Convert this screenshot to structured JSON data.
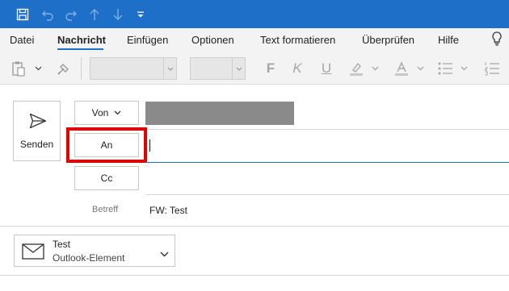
{
  "titlebar": {
    "icons": [
      "save-icon",
      "undo-icon",
      "redo-icon",
      "arrow-up-icon",
      "arrow-down-icon",
      "customize-quick-access-icon"
    ],
    "background": "#1e6fc7"
  },
  "menu": {
    "items": [
      "Datei",
      "Nachricht",
      "Einfügen",
      "Optionen",
      "Text formatieren",
      "Überprüfen",
      "Hilfe"
    ],
    "active": "Nachricht",
    "tell_me_icon": "lightbulb-icon"
  },
  "ribbon": {
    "icons": [
      "paste-icon",
      "format-painter-icon",
      "highlight-icon",
      "font-color-icon",
      "bullets-icon",
      "numbering-icon"
    ],
    "font_name": "",
    "font_size": "",
    "bold": "F",
    "italic": "K",
    "underline": "U"
  },
  "compose": {
    "send_label": "Senden",
    "from_label": "Von",
    "to_label": "An",
    "cc_label": "Cc",
    "subject_label": "Betreff",
    "subject_value": "FW: Test"
  },
  "attachment": {
    "name": "Test",
    "type": "Outlook-Element",
    "icon": "envelope-icon"
  },
  "colors": {
    "accent": "#1e6fc7",
    "highlight": "#e00000",
    "ribbon_bg": "#f3f3f3"
  }
}
